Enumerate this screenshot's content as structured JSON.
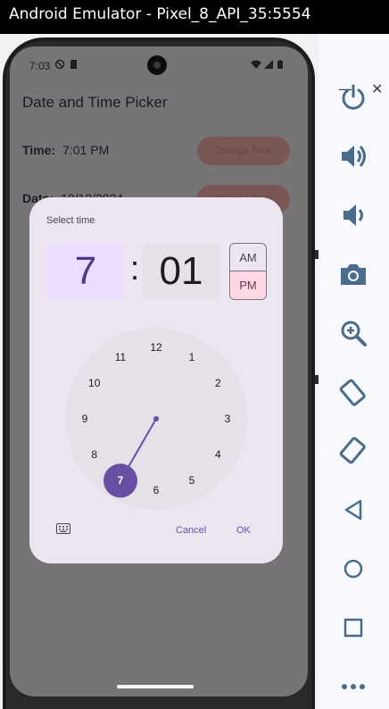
{
  "window": {
    "title": "Android Emulator - Pixel_8_API_35:5554"
  },
  "status_bar": {
    "time": "7:03"
  },
  "app": {
    "title": "Date and Time Picker",
    "time_label": "Time:",
    "time_value": "7:01 PM",
    "date_label": "Date:",
    "date_value": "10/12/2024",
    "change_time_button": "Change Time",
    "change_date_button": "Change Date"
  },
  "dialog": {
    "header": "Select time",
    "hour": "7",
    "minute": "01",
    "am": "AM",
    "pm": "PM",
    "selected_period": "PM",
    "selected_hour": 7,
    "clock_numbers": [
      "12",
      "1",
      "2",
      "3",
      "4",
      "5",
      "6",
      "7",
      "8",
      "9",
      "10",
      "11"
    ],
    "cancel_label": "Cancel",
    "ok_label": "OK"
  },
  "panel_icons": [
    "power-icon",
    "volume-up-icon",
    "volume-down-icon",
    "camera-icon",
    "zoom-icon",
    "rotate-left-icon",
    "rotate-right-icon",
    "back-icon",
    "home-icon",
    "overview-icon",
    "more-icon"
  ],
  "colors": {
    "accent": "#6750a4",
    "selected_hour_bg": "#eaddff",
    "pm_bg": "#ffd8e4",
    "dialog_bg": "#ece6f0",
    "clock_face": "#e6e0e9",
    "panel_icon": "#4a6c8c"
  }
}
